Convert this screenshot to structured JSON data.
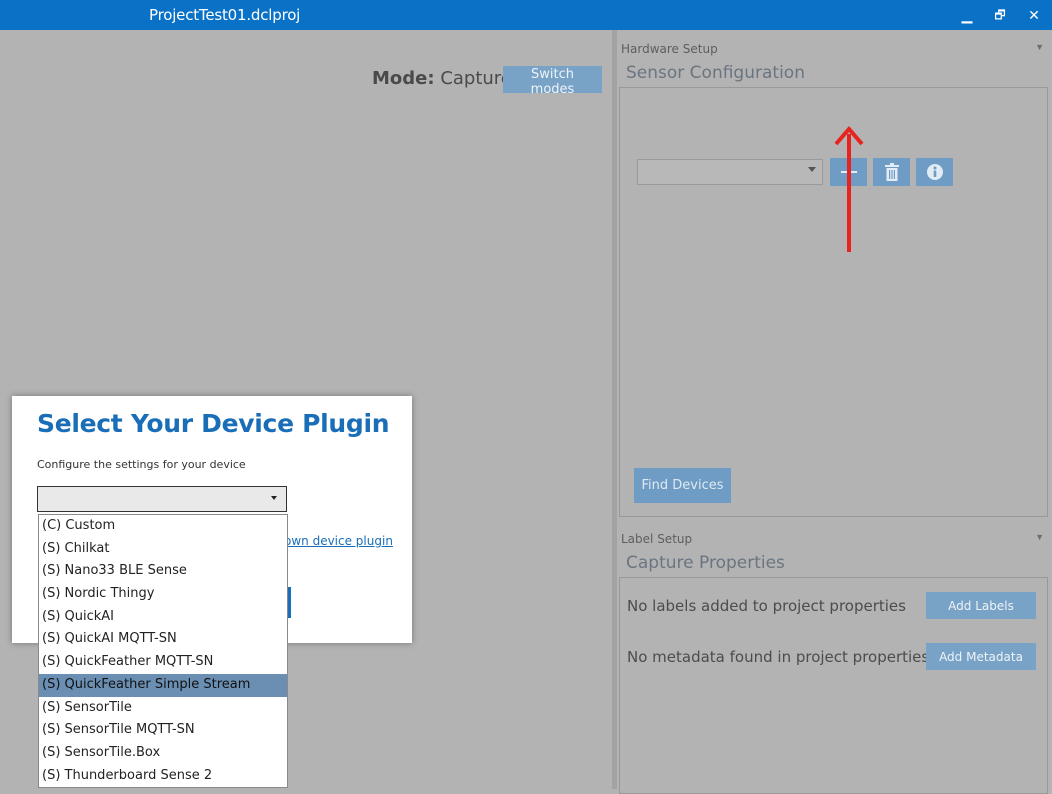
{
  "window": {
    "title": "ProjectTest01.dclproj",
    "minimize_glyph": "▁",
    "maximize_glyph": "🗗",
    "close_glyph": "✕"
  },
  "mode": {
    "label": "Mode:",
    "value": "Capture",
    "switch_label": "Switch modes"
  },
  "hardware_setup": {
    "caption": "Hardware Setup",
    "title": "Sensor Configuration",
    "sensor_select_value": "",
    "find_devices_label": "Find Devices"
  },
  "label_setup": {
    "caption": "Label Setup",
    "title": "Capture Properties",
    "no_labels_text": "No labels added to project properties",
    "add_labels_label": "Add Labels",
    "no_metadata_text": "No metadata found in project properties",
    "add_metadata_label": "Add Metadata"
  },
  "dialog": {
    "title": "Select Your Device Plugin",
    "description": "Configure the settings for your device",
    "selected_value": "",
    "link_text": "own device plugin"
  },
  "dropdown": {
    "options": [
      "(C) Custom",
      "(S) Chilkat",
      "(S) Nano33 BLE Sense",
      "(S) Nordic Thingy",
      "(S) QuickAI",
      "(S) QuickAI MQTT-SN",
      "(S) QuickFeather MQTT-SN",
      "(S) QuickFeather Simple Stream",
      "(S) SensorTile",
      "(S) SensorTile MQTT-SN",
      "(S) SensorTile.Box",
      "(S) Thunderboard Sense 2"
    ],
    "highlighted": "(S) QuickFeather Simple Stream"
  },
  "colors": {
    "titlebar": "#0a72c6",
    "accent_button": "#6f9cc4",
    "dialog_title": "#1a6eb8",
    "highlight": "#6b8fb3",
    "annotation_arrow": "#e8231f"
  },
  "icons": {
    "add": "plus-icon",
    "delete": "trash-icon",
    "info": "info-icon"
  }
}
